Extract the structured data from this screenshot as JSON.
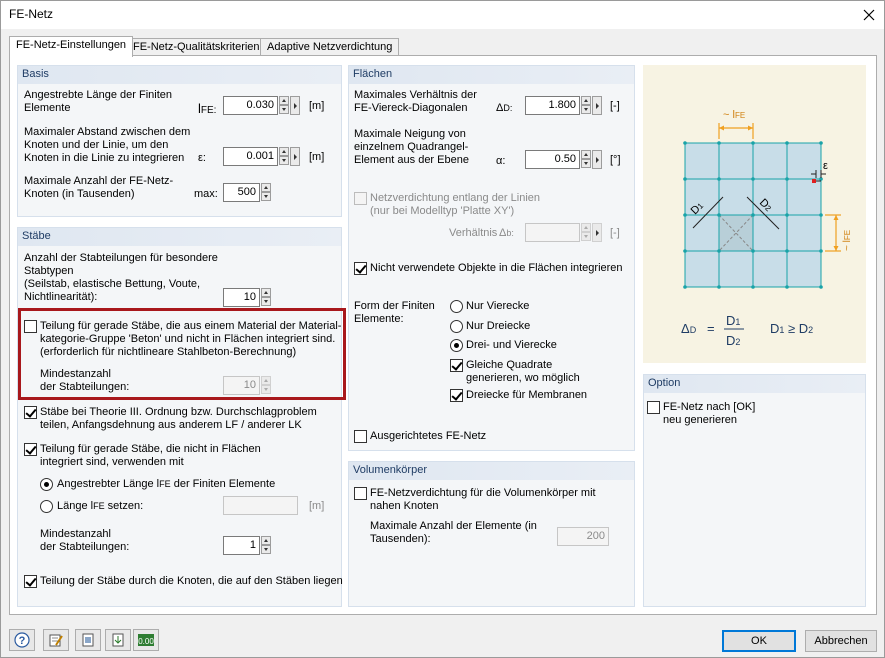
{
  "window": {
    "title": "FE-Netz"
  },
  "tabs": [
    "FE-Netz-Einstellungen",
    "FE-Netz-Qualitätskriterien",
    "Adaptive Netzverdichtung"
  ],
  "basis": {
    "header": "Basis",
    "length_label_1": "Angestrebte Länge der Finiten",
    "length_label_2": "Elemente",
    "length_sym": "l",
    "length_sub": "FE:",
    "length_value": "0.030",
    "length_unit": "[m]",
    "dist_label_1": "Maximaler Abstand zwischen dem",
    "dist_label_2": "Knoten und der Linie, um den",
    "dist_label_3": "Knoten in die Linie zu integrieren",
    "dist_sym": "ε:",
    "dist_value": "0.001",
    "dist_unit": "[m]",
    "nodes_label_1": "Maximale Anzahl der FE-Netz-",
    "nodes_label_2": "Knoten (in Tausenden)",
    "nodes_sym": "max:",
    "nodes_value": "500"
  },
  "staebe": {
    "header": "Stäbe",
    "div_label_1": "Anzahl der Stabteilungen für besondere",
    "div_label_2": "Stabtypen",
    "div_label_3": "(Seilstab, elastische Bettung, Voute,",
    "div_label_4": "Nichtlinearität):",
    "div_value": "10",
    "beton_cb_1": "Teilung für gerade Stäbe, die aus einem Material der Material-",
    "beton_cb_2": "kategorie-Gruppe 'Beton' und nicht in Flächen integriert sind.",
    "beton_cb_3": "(erforderlich für nichtlineare Stahlbeton-Berechnung)",
    "beton_min_1": "Mindestanzahl",
    "beton_min_2": "der Stabteilungen:",
    "beton_min_value": "10",
    "theorie_cb_1": "Stäbe bei Theorie III. Ordnung bzw. Durchschlagproblem",
    "theorie_cb_2": "teilen, Anfangsdehnung aus anderem LF / anderer LK",
    "gerade_cb_1": "Teilung für gerade Stäbe, die nicht in Flächen",
    "gerade_cb_2": "integriert sind, verwenden mit",
    "radio_1_pre": "Angestrebter Länge l",
    "radio_1_sub": "FE",
    "radio_1_post": " der Finiten Elemente",
    "radio_2_pre": "Länge l",
    "radio_2_sub": "FE",
    "radio_2_post": " setzen:",
    "radio_2_unit": "[m]",
    "min_1": "Mindestanzahl",
    "min_2": "der Stabteilungen:",
    "min_value": "1",
    "knoten_cb": "Teilung der Stäbe durch die Knoten, die auf den Stäben liegen"
  },
  "flaechen": {
    "header": "Flächen",
    "ratio_label_1": "Maximales Verhältnis der",
    "ratio_label_2": "FE-Viereck-Diagonalen",
    "ratio_sym": "Δ",
    "ratio_sub": "D:",
    "ratio_value": "1.800",
    "ratio_unit": "[-]",
    "tilt_label_1": "Maximale Neigung von",
    "tilt_label_2": "einzelnem Quadrangel-",
    "tilt_label_3": "Element aus der Ebene",
    "tilt_sym": "α:",
    "tilt_value": "0.50",
    "tilt_unit": "[°]",
    "verd_cb_1": "Netzverdichtung entlang der Linien",
    "verd_cb_2": "(nur bei Modelltyp 'Platte XY')",
    "verd_ratio_label": "Verhältnis",
    "verd_ratio_sym": "Δ",
    "verd_ratio_sub": "b:",
    "verd_ratio_unit": "[-]",
    "unused_cb": "Nicht verwendete Objekte in die Flächen integrieren",
    "form_label_1": "Form der Finiten",
    "form_label_2": "Elemente:",
    "form_opt_1": "Nur Vierecke",
    "form_opt_2": "Nur Dreiecke",
    "form_opt_3": "Drei- und Vierecke",
    "gleiche_cb_1": "Gleiche Quadrate",
    "gleiche_cb_2": "generieren, wo möglich",
    "dreiecke_cb": "Dreiecke für Membranen",
    "ausgerichtet_cb": "Ausgerichtetes FE-Netz"
  },
  "volumen": {
    "header": "Volumenkörper",
    "cb_1": "FE-Netzverdichtung für die Volumenkörper mit",
    "cb_2": "nahen Knoten",
    "max_label_1": "Maximale Anzahl der Elemente (in",
    "max_label_2": "Tausenden):",
    "max_value": "200"
  },
  "preview": {
    "lfe_label": "~ l",
    "lfe_sub": "FE",
    "eps_label": "ε",
    "d1": "D",
    "d1_sub": "1",
    "d2": "D",
    "d2_sub": "2",
    "formula_lhs": "Δ",
    "formula_lhs_sub": "D",
    "formula_eq": "=",
    "formula_num": "D",
    "formula_num_sub": "1",
    "formula_den": "D",
    "formula_den_sub": "2",
    "formula_cond": "D",
    "formula_cond_sub": "1",
    "formula_cond_mid": " ≥ D",
    "formula_cond_sub2": "2"
  },
  "option": {
    "header": "Option",
    "cb_1": "FE-Netz nach [OK]",
    "cb_2": "neu generieren"
  },
  "buttons": {
    "ok": "OK",
    "cancel": "Abbrechen"
  },
  "colors": {
    "accent_red": "#a8181c",
    "mesh_teal": "#19a3a8",
    "dim_orange": "#f0a020",
    "group_header": "#dfe7f1"
  }
}
